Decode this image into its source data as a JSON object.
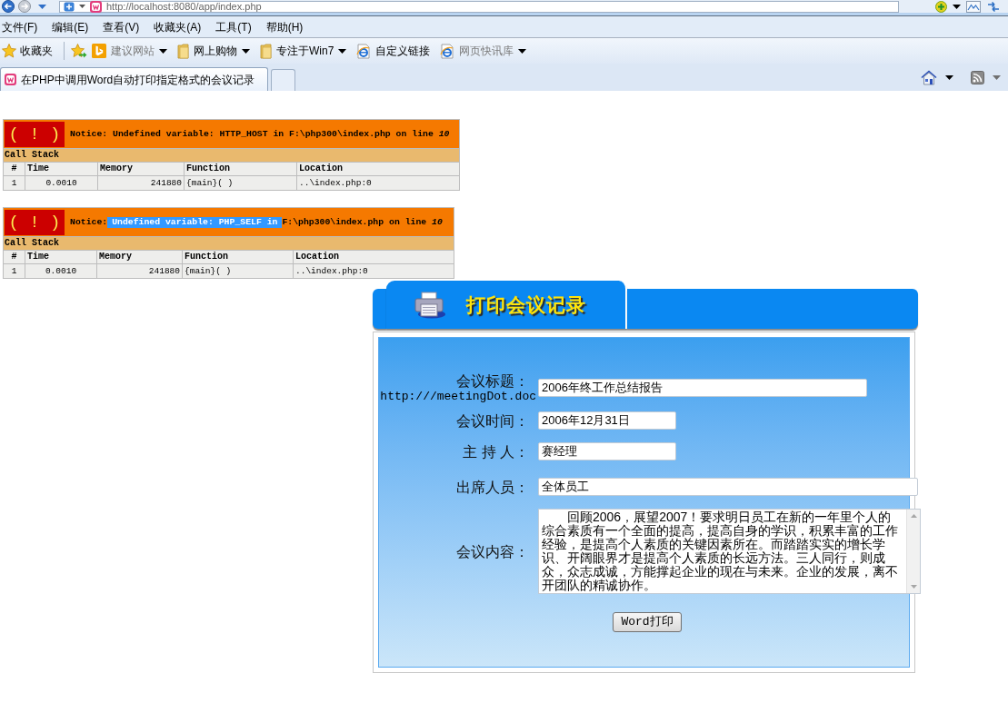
{
  "browser": {
    "address_bar": {
      "url": "http://localhost:8080/app/index.php"
    },
    "menu": [
      "文件(F)",
      "编辑(E)",
      "查看(V)",
      "收藏夹(A)",
      "工具(T)",
      "帮助(H)"
    ],
    "favorites_bar": {
      "label": "收藏夹",
      "links": [
        {
          "label": "建议网站",
          "kind": "logo",
          "dropdown": true,
          "disabled": true
        },
        {
          "label": "网上购物",
          "kind": "folder",
          "dropdown": true,
          "disabled": false
        },
        {
          "label": "专注于Win7",
          "kind": "folder",
          "dropdown": true,
          "disabled": false
        },
        {
          "label": "自定义链接",
          "kind": "page",
          "dropdown": false,
          "disabled": false
        },
        {
          "label": "网页快讯库",
          "kind": "page",
          "dropdown": true,
          "disabled": true
        }
      ]
    },
    "tabs": [
      {
        "label": "在PHP中调用Word自动打印指定格式的会议记录",
        "selected": true
      }
    ]
  },
  "errors": [
    {
      "marker": "( ! )",
      "message": [
        {
          "text": "Notice: Undefined variable: HTTP_HOST in F:\\php300\\index.php on line *10*",
          "selected": false
        }
      ],
      "stack_title": "Call Stack",
      "columns": [
        "#",
        "Time",
        "Memory",
        "Function",
        "Location"
      ],
      "rows": [
        [
          "1",
          "0.0010",
          "241880",
          "{main}( )",
          "..\\index.php:0"
        ]
      ]
    },
    {
      "marker": "( ! )",
      "message": [
        {
          "text": "Notice:",
          "selected": false
        },
        {
          "text": "Undefined variable: PHP_SELF in",
          "selected": true
        },
        {
          "text": "F:\\php300\\index.php on line *10*",
          "selected": false
        }
      ],
      "stack_title": "Call Stack",
      "columns": [
        "#",
        "Time",
        "Memory",
        "Function",
        "Location"
      ],
      "rows": [
        [
          "1",
          "0.0010",
          "241880",
          "{main}( )",
          "..\\index.php:0"
        ]
      ]
    }
  ],
  "form": {
    "title": "打印会议记录",
    "fields": [
      {
        "label": "会议标题：",
        "note": "http:///meetingDot.doc",
        "kind": "text",
        "value": "2006年终工作总结报告"
      },
      {
        "label": "会议时间：",
        "kind": "text",
        "value": "2006年12月31日"
      },
      {
        "label": "主 持 人：",
        "kind": "text",
        "value": "赛经理"
      },
      {
        "label": "出席人员：",
        "kind": "text",
        "value": "全体员工"
      },
      {
        "label": "会议内容：",
        "kind": "textarea",
        "value": "回顾2006，展望2007！要求明日员工在新的一年里个人的综合素质有一个全面的提高，提高自身的学识，积累丰富的工作经验，是提高个人素质的关键因素所在。而踏踏实实的增长学识、开阔眼界才是提高个人素质的长远方法。三人同行，则成众，众志成诚，方能撑起企业的现在与未来。企业的发展，离不开团队的精诚协作。"
      }
    ],
    "submit_button": "Word打印"
  }
}
